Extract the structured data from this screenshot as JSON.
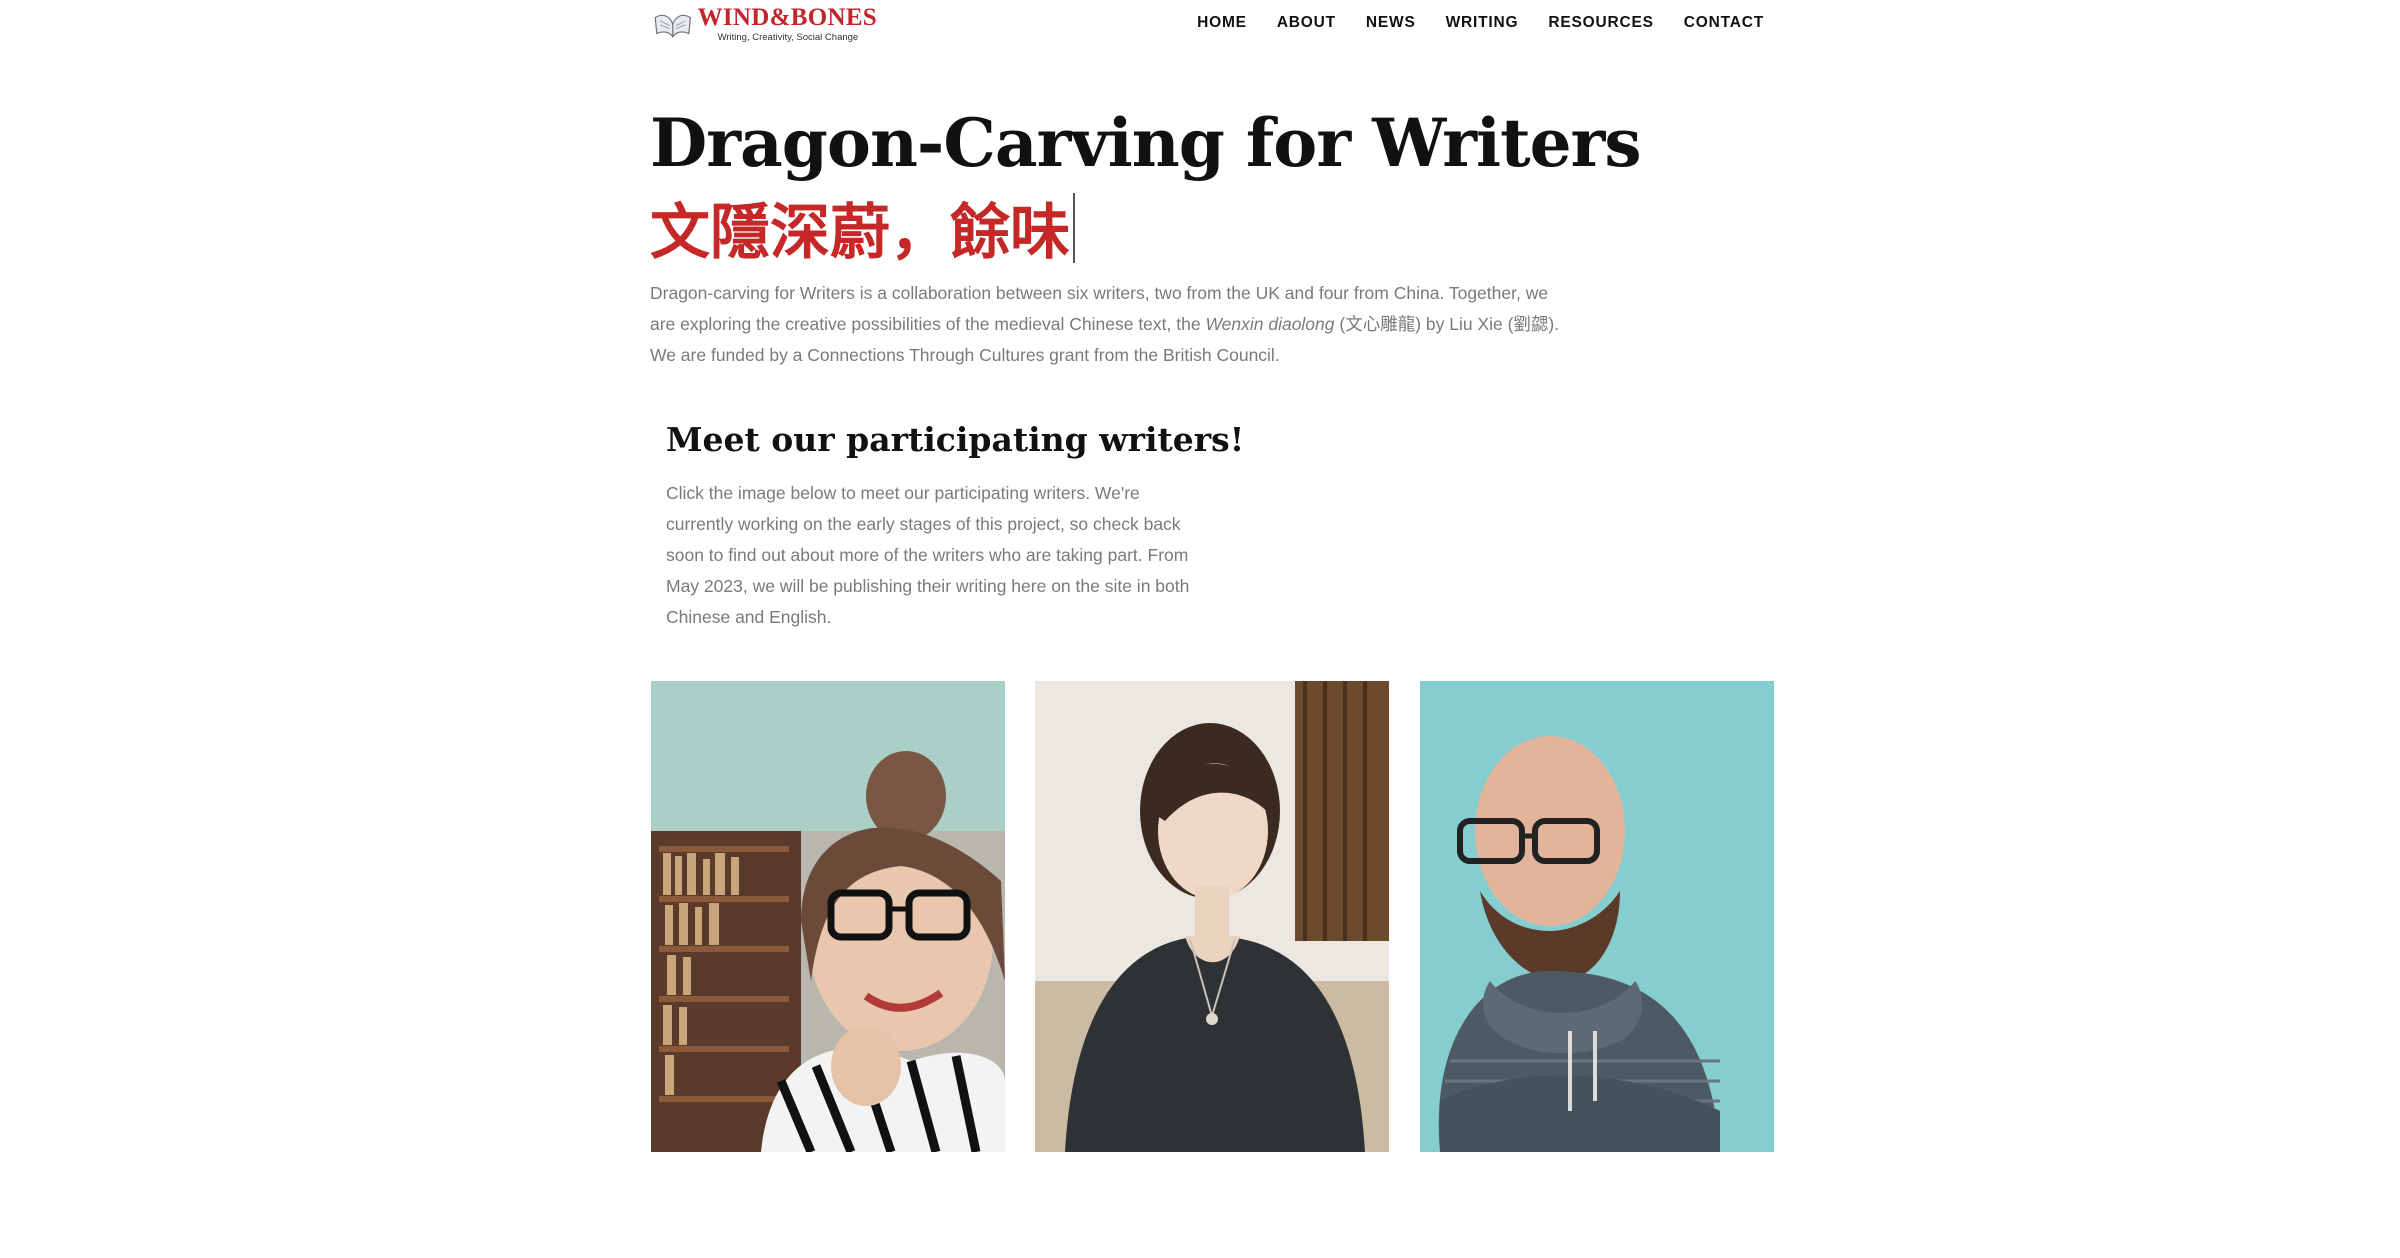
{
  "header": {
    "logo": {
      "name": "WIND&BONES",
      "tagline": "Writing, Creativity, Social Change"
    },
    "nav": [
      "HOME",
      "ABOUT",
      "NEWS",
      "WRITING",
      "RESOURCES",
      "CONTACT"
    ]
  },
  "page": {
    "title": "Dragon-Carving for Writers",
    "subtitle": "文隱深蔚，餘味",
    "intro": {
      "part1": "Dragon-carving for Writers is a collaboration between six writers, two from the UK and four from China. Together, we are exploring the creative possibilities of the medieval Chinese text, the ",
      "italic": "Wenxin diaolong",
      "part2": " (文心雕龍) by Liu Xie (劉勰). We are funded by a Connections Through Cultures grant from the British Council."
    },
    "section": {
      "title": "Meet our participating writers!",
      "body": "Click the image below to meet our participating writers. We're currently working on the early stages of this project, so check back soon to find out about more of the writers who are taking part. From May 2023, we will be publishing their writing here on the site in both Chinese and English."
    }
  },
  "colors": {
    "accent_red": "#c62828",
    "body_grey": "#7a7a7a",
    "heading": "#111111"
  }
}
